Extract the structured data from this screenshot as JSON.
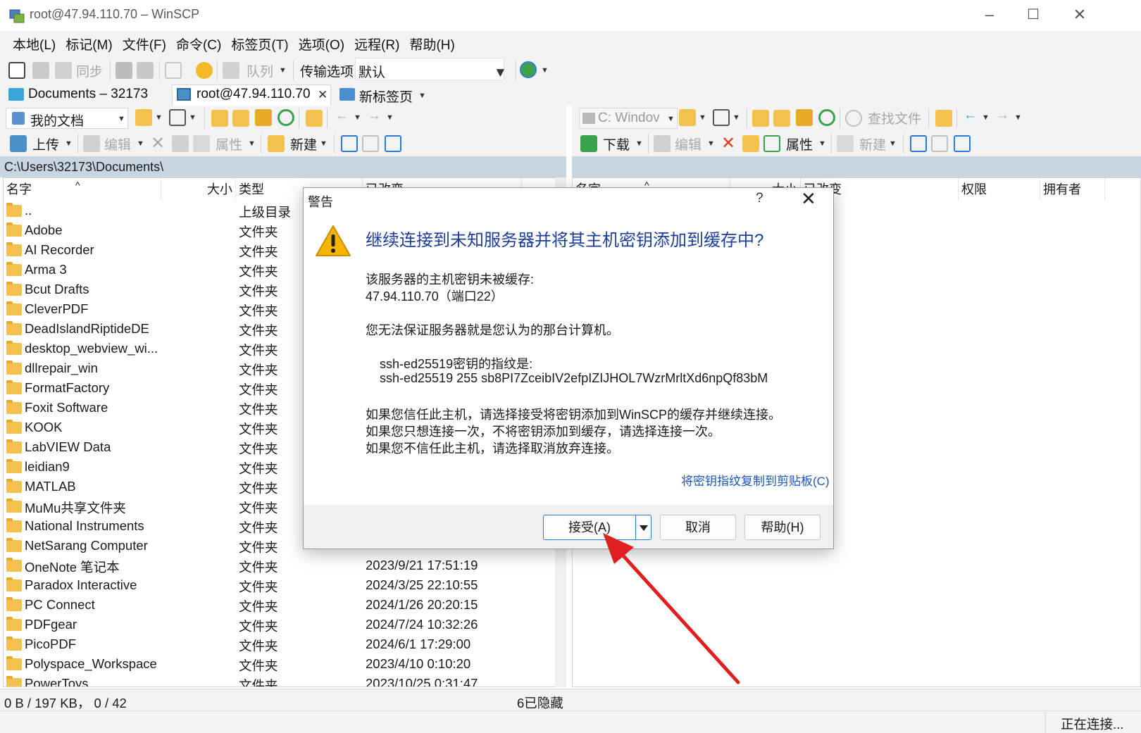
{
  "window": {
    "title": "root@47.94.110.70 – WinSCP",
    "controls": {
      "minimize": "–",
      "maximize": "☐",
      "close": "✕"
    }
  },
  "menubar": {
    "items": [
      "本地(L)",
      "标记(M)",
      "文件(F)",
      "命令(C)",
      "标签页(T)",
      "选项(O)",
      "远程(R)",
      "帮助(H)"
    ]
  },
  "toolbar": {
    "sync_label": "同步",
    "queue_label": "队列",
    "transfer_options_label": "传输选项",
    "transfer_preset": "默认"
  },
  "tabs": [
    {
      "label": "Documents – 32173"
    },
    {
      "label": "root@47.94.110.70",
      "close": "✕"
    },
    {
      "label": "新标签页"
    }
  ],
  "left_panel": {
    "location": "我的文档",
    "upload_label": "上传",
    "edit_label": "编辑",
    "properties_label": "属性",
    "new_label": "新建",
    "path": "C:\\Users\\32173\\Documents\\",
    "columns": [
      "名字",
      "大小",
      "类型",
      "已改变"
    ],
    "rows": [
      {
        "name": "..",
        "type": "上级目录",
        "modified": ""
      },
      {
        "name": "Adobe",
        "type": "文件夹",
        "modified": ""
      },
      {
        "name": "AI Recorder",
        "type": "文件夹",
        "modified": ""
      },
      {
        "name": "Arma 3",
        "type": "文件夹",
        "modified": ""
      },
      {
        "name": "Bcut Drafts",
        "type": "文件夹",
        "modified": ""
      },
      {
        "name": "CleverPDF",
        "type": "文件夹",
        "modified": ""
      },
      {
        "name": "DeadIslandRiptideDE",
        "type": "文件夹",
        "modified": ""
      },
      {
        "name": "desktop_webview_wi...",
        "type": "文件夹",
        "modified": ""
      },
      {
        "name": "dllrepair_win",
        "type": "文件夹",
        "modified": ""
      },
      {
        "name": "FormatFactory",
        "type": "文件夹",
        "modified": ""
      },
      {
        "name": "Foxit Software",
        "type": "文件夹",
        "modified": ""
      },
      {
        "name": "KOOK",
        "type": "文件夹",
        "modified": ""
      },
      {
        "name": "LabVIEW Data",
        "type": "文件夹",
        "modified": ""
      },
      {
        "name": "leidian9",
        "type": "文件夹",
        "modified": ""
      },
      {
        "name": "MATLAB",
        "type": "文件夹",
        "modified": ""
      },
      {
        "name": "MuMu共享文件夹",
        "type": "文件夹",
        "modified": ""
      },
      {
        "name": "National Instruments",
        "type": "文件夹",
        "modified": ""
      },
      {
        "name": "NetSarang Computer",
        "type": "文件夹",
        "modified": ""
      },
      {
        "name": "OneNote 笔记本",
        "type": "文件夹",
        "modified": "2023/9/21 17:51:19"
      },
      {
        "name": "Paradox Interactive",
        "type": "文件夹",
        "modified": "2024/3/25 22:10:55"
      },
      {
        "name": "PC Connect",
        "type": "文件夹",
        "modified": "2024/1/26 20:20:15"
      },
      {
        "name": "PDFgear",
        "type": "文件夹",
        "modified": "2024/7/24 10:32:26"
      },
      {
        "name": "PicoPDF",
        "type": "文件夹",
        "modified": "2024/6/1 17:29:00"
      },
      {
        "name": "Polyspace_Workspace",
        "type": "文件夹",
        "modified": "2023/4/10 0:10:20"
      },
      {
        "name": "PowerToys",
        "type": "文件夹",
        "modified": "2023/10/25 0:31:47"
      }
    ]
  },
  "right_panel": {
    "location": "C: Windov",
    "find_files_label": "查找文件",
    "download_label": "下载",
    "edit_label": "编辑",
    "properties_label": "属性",
    "new_label": "新建",
    "columns": [
      "名字",
      "大小",
      "已改变",
      "权限",
      "拥有者"
    ]
  },
  "statusbar": {
    "selection": "0 B / 197 KB， 0 / 42",
    "hidden": "6已隐藏",
    "connection": "正在连接..."
  },
  "dialog": {
    "title": "警告",
    "help_symbol": "?",
    "close_symbol": "✕",
    "heading": "继续连接到未知服务器并将其主机密钥添加到缓存中?",
    "line1": "该服务器的主机密钥未被缓存:",
    "line2": "47.94.110.70（端口22）",
    "line3": "您无法保证服务器就是您认为的那台计算机。",
    "fingerprint_label": "ssh-ed25519密钥的指纹是:",
    "fingerprint": "ssh-ed25519 255 sb8PI7ZceibIV2efpIZIJHOL7WzrMrltXd6npQf83bM",
    "advice1": "如果您信任此主机，请选择接受将密钥添加到WinSCP的缓存并继续连接。",
    "advice2": "如果您只想连接一次，不将密钥添加到缓存，请选择连接一次。",
    "advice3": "如果您不信任此主机，请选择取消放弃连接。",
    "copy_link": "将密钥指纹复制到剪贴板(C)",
    "accept_label": "接受(A)",
    "cancel_label": "取消",
    "help_label": "帮助(H)"
  },
  "colors": {
    "path_bar": "#c8d6e2",
    "heading_blue": "#1c3f9a",
    "link_blue": "#1c55b8",
    "arrow_red": "#e02020",
    "folder_yellow": "#f2c14e"
  }
}
